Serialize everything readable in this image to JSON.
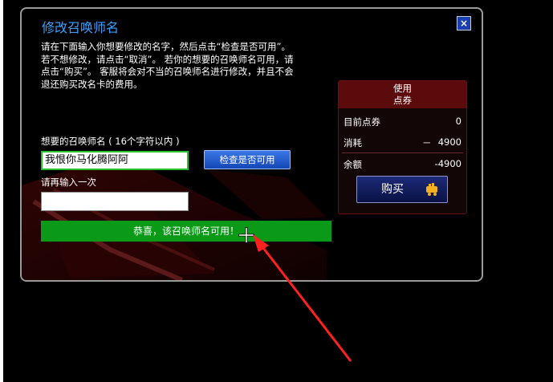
{
  "dialog": {
    "title": "修改召唤师名",
    "close_symbol": "×",
    "intro_lines": [
      "请在下面输入你想要修改的名字，然后点击“检查是否可用”。",
      "若不想修改，请点击“取消”。 若你的想要的召唤师名可用，请",
      "点击“购买”。 客服将会对不当的召唤师名进行修改，并且不会",
      "退还购买改名卡的费用。"
    ],
    "name_label": "想要的召唤师名 ( 16个字符以内 )",
    "name_value": "我恨你马化腾阿阿",
    "check_button": "检查是否可用",
    "confirm_label": "请再输入一次",
    "confirm_value": "",
    "status_message": "恭喜，该召唤师名可用！"
  },
  "panel": {
    "header_line1": "使用",
    "header_line2": "点券",
    "current_label": "目前点券",
    "current_value": "0",
    "cost_label": "消耗",
    "cost_sign": "－",
    "cost_value": "4900",
    "balance_label": "余额",
    "balance_value": "-4900",
    "buy_button": "购买"
  },
  "colors": {
    "title": "#3aa0ff",
    "status_bar": "#0a9a17",
    "panel_header": "#5b0b0b",
    "arrow": "#ff2020"
  },
  "icons": [
    "close-icon",
    "cart-icon",
    "crosshair-cursor-icon",
    "red-arrow-annotation"
  ]
}
